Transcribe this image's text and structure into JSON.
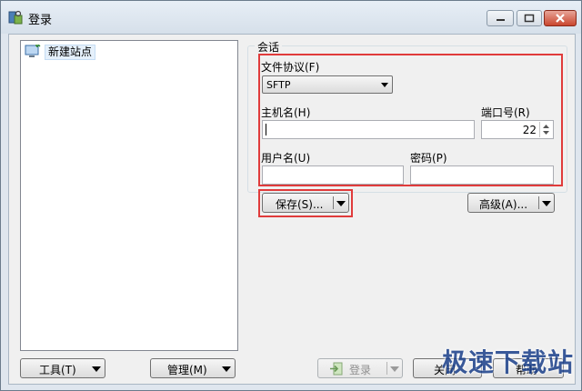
{
  "window": {
    "title": "登录"
  },
  "tree": {
    "items": [
      {
        "label": "新建站点"
      }
    ]
  },
  "left_buttons": {
    "tools": "工具(T)",
    "manage": "管理(M)"
  },
  "session": {
    "legend": "会话",
    "protocol_label": "文件协议(F)",
    "protocol_value": "SFTP",
    "host_label": "主机名(H)",
    "host_value": "",
    "port_label": "端口号(R)",
    "port_value": "22",
    "user_label": "用户名(U)",
    "user_value": "",
    "password_label": "密码(P)",
    "password_value": "",
    "save_label": "保存(S)...",
    "advanced_label": "高级(A)..."
  },
  "bottom_buttons": {
    "login": "登录",
    "close": "关闭",
    "help": "帮助"
  },
  "watermark": "极速下载站",
  "colors": {
    "highlight_box": "#e03b3b",
    "window_frame": "#dfe6ee"
  }
}
